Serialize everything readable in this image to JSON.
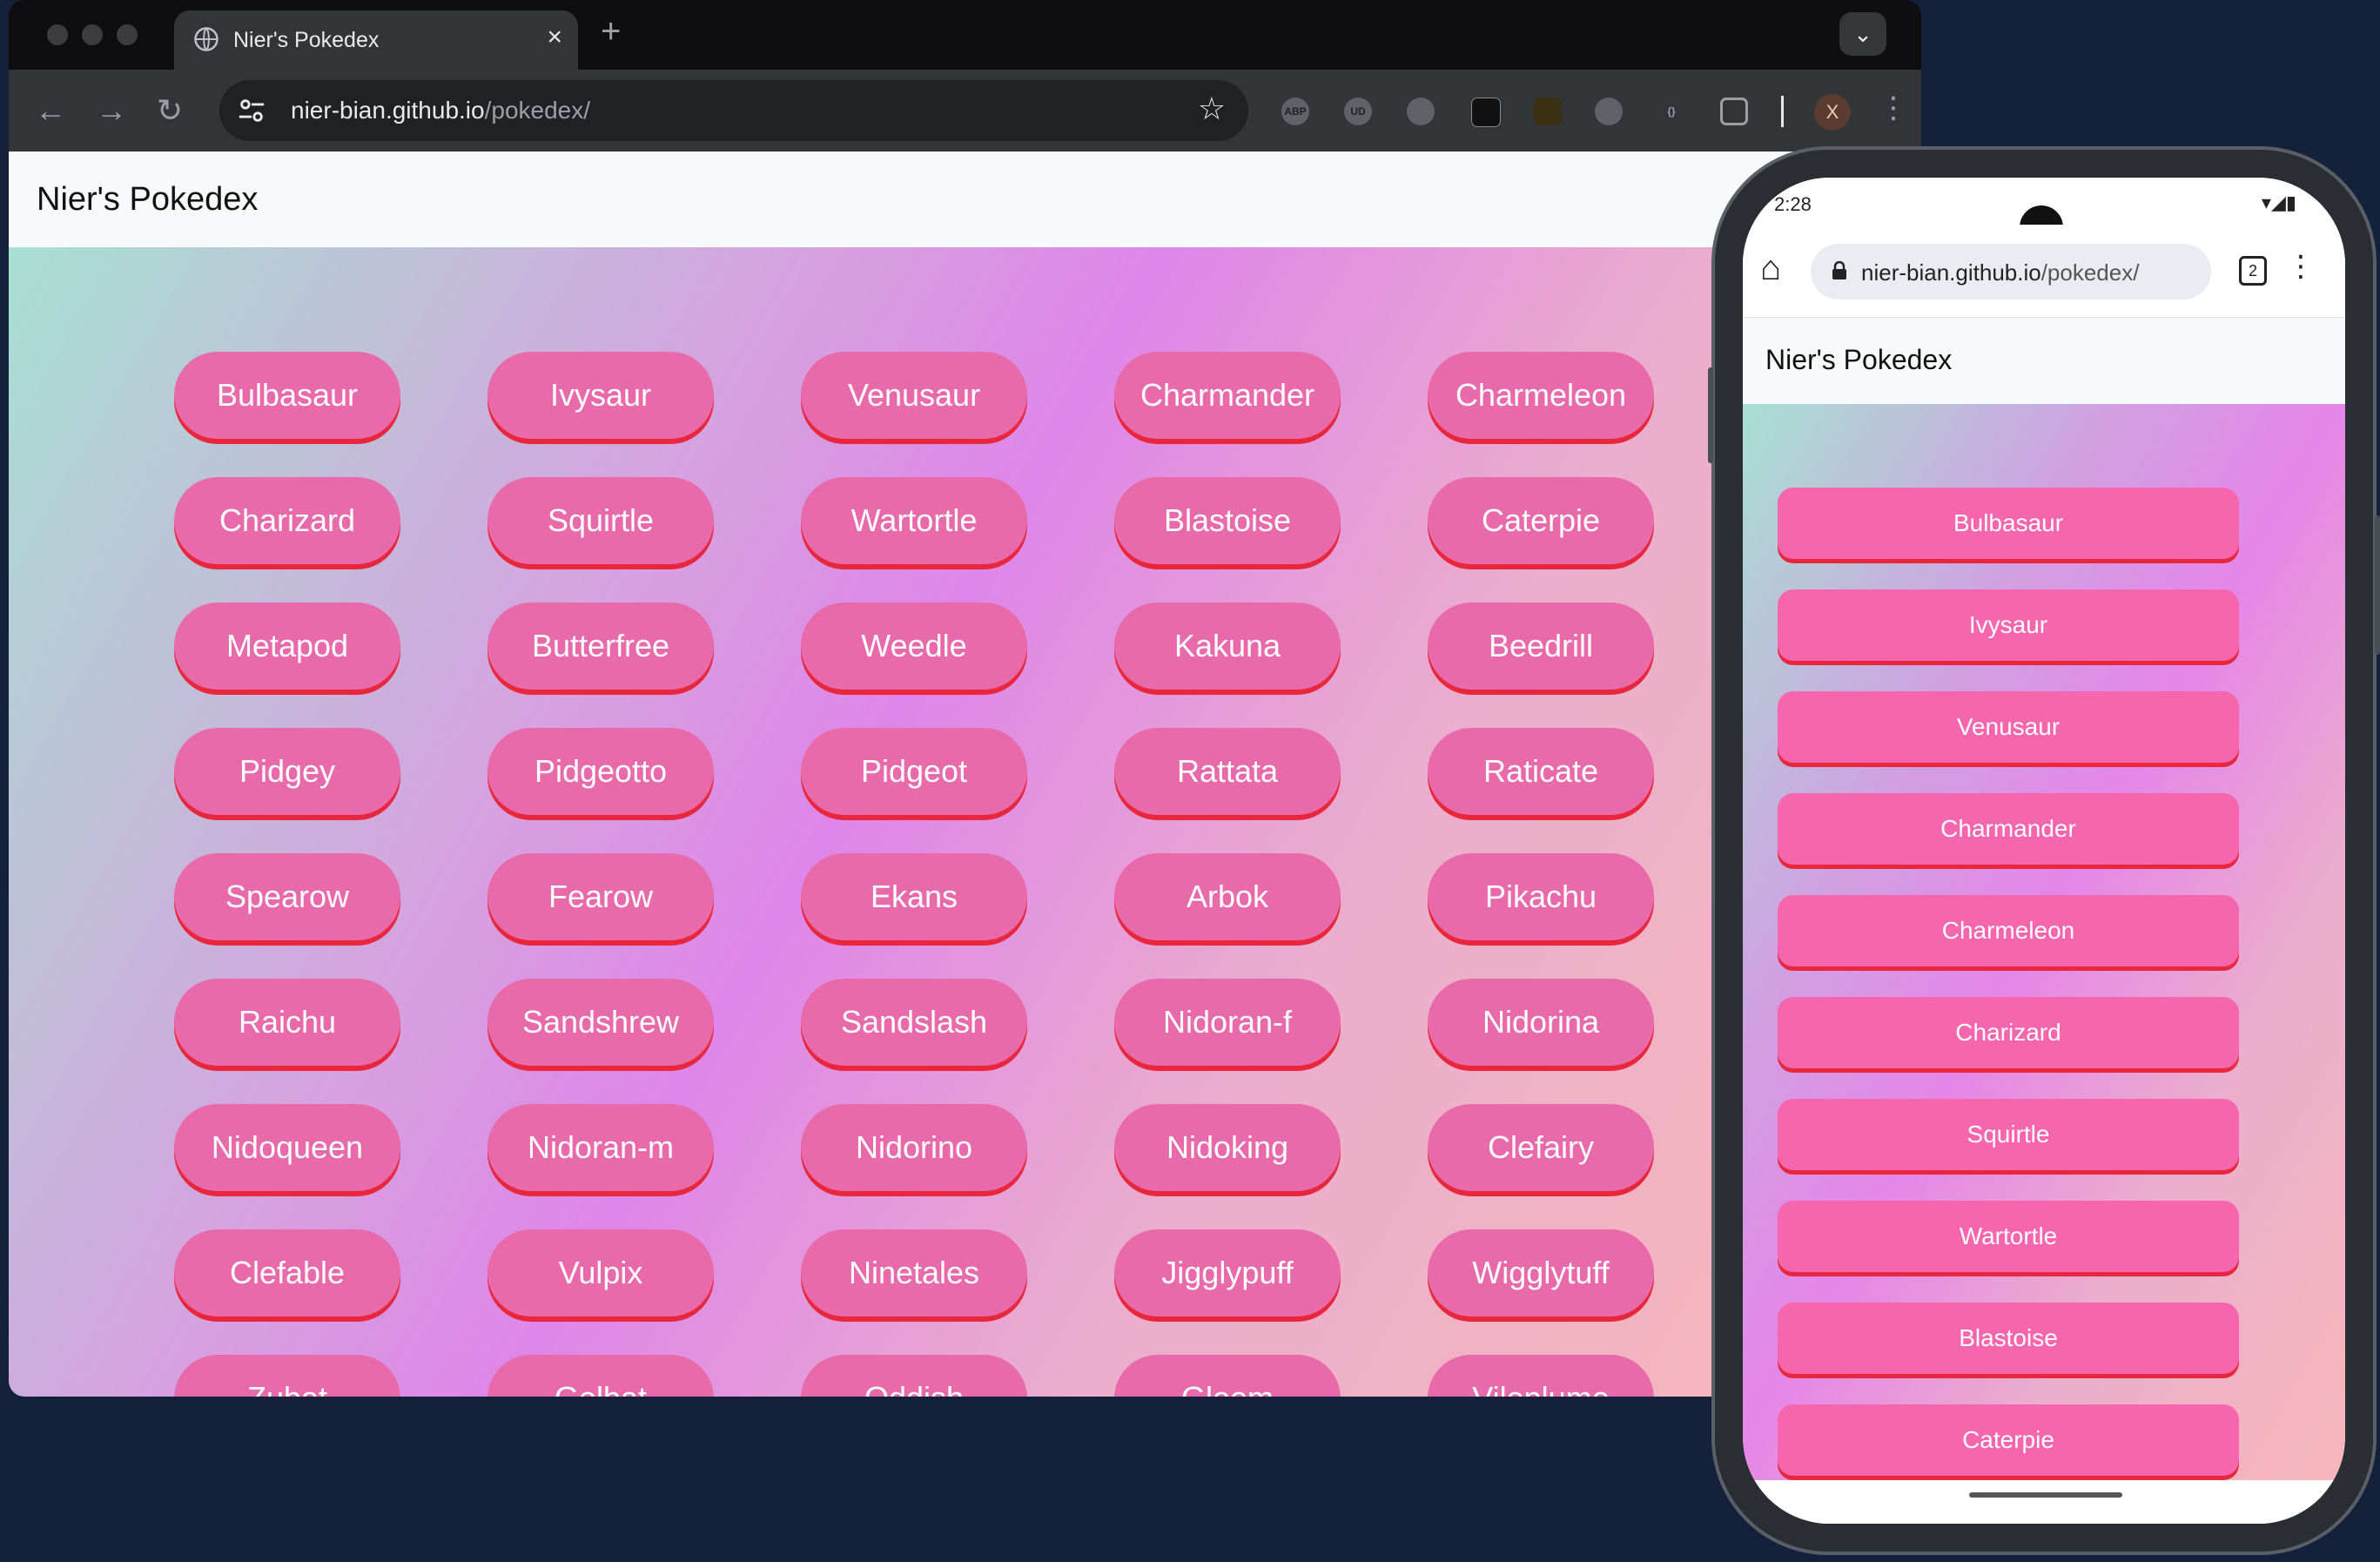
{
  "browser": {
    "tab_title": "Nier's Pokedex",
    "new_tab_label": "+",
    "url_host": "nier-bian.github.io",
    "url_path": "/pokedex/",
    "extensions": [
      "ABP",
      "UD",
      "",
      "",
      "",
      "",
      "{}"
    ],
    "profile_initial": "X"
  },
  "site": {
    "title": "Nier's Pokedex",
    "pokemon": [
      "Bulbasaur",
      "Ivysaur",
      "Venusaur",
      "Charmander",
      "Charmeleon",
      "Charizard",
      "Squirtle",
      "Wartortle",
      "Blastoise",
      "Caterpie",
      "Metapod",
      "Butterfree",
      "Weedle",
      "Kakuna",
      "Beedrill",
      "Pidgey",
      "Pidgeotto",
      "Pidgeot",
      "Rattata",
      "Raticate",
      "Spearow",
      "Fearow",
      "Ekans",
      "Arbok",
      "Pikachu",
      "Raichu",
      "Sandshrew",
      "Sandslash",
      "Nidoran-f",
      "Nidorina",
      "Nidoqueen",
      "Nidoran-m",
      "Nidorino",
      "Nidoking",
      "Clefairy",
      "Clefable",
      "Vulpix",
      "Ninetales",
      "Jigglypuff",
      "Wigglytuff",
      "Zubat",
      "Golbat",
      "Oddish",
      "Gloom",
      "Vileplume"
    ]
  },
  "mobile": {
    "time": "2:28",
    "url_host": "nier-bian.github.io",
    "url_path": "/pokedex/",
    "tab_count": "2",
    "title": "Nier's Pokedex",
    "pokemon": [
      "Bulbasaur",
      "Ivysaur",
      "Venusaur",
      "Charmander",
      "Charmeleon",
      "Charizard",
      "Squirtle",
      "Wartortle",
      "Blastoise",
      "Caterpie",
      ""
    ]
  },
  "colors": {
    "button_fill": "#e86aaa",
    "button_shadow": "#e8273c",
    "mobile_button_fill": "#f666ae",
    "desktop_bg": "#13223a"
  }
}
